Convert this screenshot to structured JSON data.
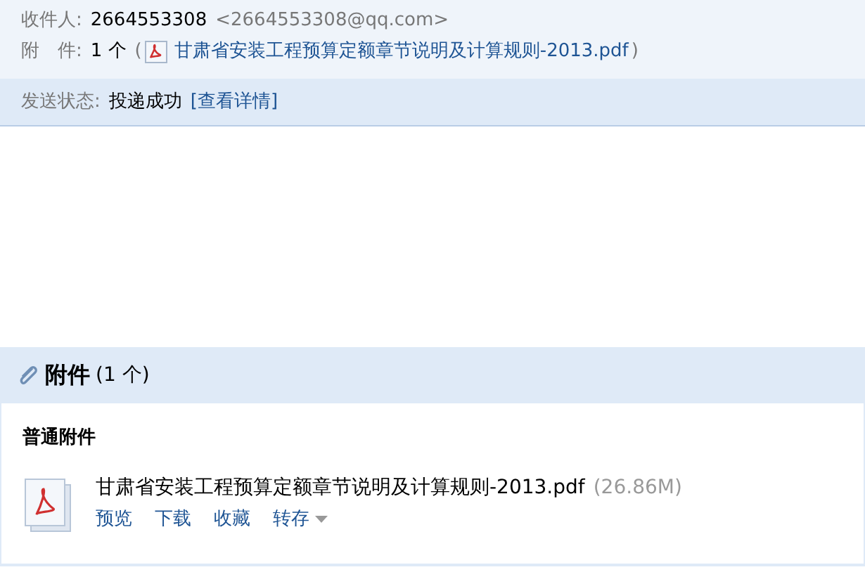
{
  "header": {
    "recipient_label": "收件人:",
    "recipient_name": "2664553308",
    "recipient_email": "<2664553308@qq.com>",
    "attachment_label": "附　件:",
    "attachment_count": "1 个",
    "attachment_open": "(",
    "attachment_name": "甘肃省安装工程预算定额章节说明及计算规则-2013.pdf",
    "attachment_close": ")"
  },
  "status": {
    "label": "发送状态:",
    "value": "投递成功",
    "link": "[查看详情]"
  },
  "attachments": {
    "title": "附件",
    "count": "(1 个)",
    "group": "普通附件",
    "files": [
      {
        "name": "甘肃省安装工程预算定额章节说明及计算规则-2013.pdf",
        "size": "(26.86M)",
        "actions": [
          "预览",
          "下载",
          "收藏"
        ],
        "dropdown": "转存"
      }
    ]
  }
}
